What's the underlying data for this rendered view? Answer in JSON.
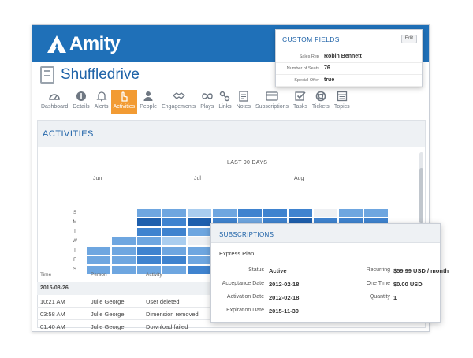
{
  "app": {
    "logo_text": "Amity"
  },
  "account": {
    "name": "Shuffledrive"
  },
  "tabs": [
    {
      "label": "Dashboard",
      "icon": "dashboard-icon",
      "active": false
    },
    {
      "label": "Details",
      "icon": "info-icon",
      "active": false
    },
    {
      "label": "Alerts",
      "icon": "bell-icon",
      "active": false
    },
    {
      "label": "Activities",
      "icon": "hand-pointer-icon",
      "active": true
    },
    {
      "label": "People",
      "icon": "person-icon",
      "active": false
    },
    {
      "label": "Engagements",
      "icon": "handshake-icon",
      "active": false
    },
    {
      "label": "Plays",
      "icon": "infinity-icon",
      "active": false
    },
    {
      "label": "Links",
      "icon": "link-icon",
      "active": false
    },
    {
      "label": "Notes",
      "icon": "note-icon",
      "active": false
    },
    {
      "label": "Subscriptions",
      "icon": "card-icon",
      "active": false
    },
    {
      "label": "Tasks",
      "icon": "checkbox-icon",
      "active": false
    },
    {
      "label": "Tickets",
      "icon": "lifebuoy-icon",
      "active": false
    },
    {
      "label": "Topics",
      "icon": "topics-icon",
      "active": false
    }
  ],
  "activities": {
    "title": "ACTIVITIES",
    "heatmap_title": "LAST 90 DAYS",
    "months": [
      "Jun",
      "Jul",
      "Aug"
    ],
    "days": [
      "S",
      "M",
      "T",
      "W",
      "T",
      "F",
      "S"
    ],
    "table_headers": {
      "time": "Time",
      "person": "Person",
      "activity": "Activity"
    },
    "date_group": "2015-08-26",
    "rows": [
      {
        "time": "10:21 AM",
        "person": "Julie George",
        "activity": "User deleted"
      },
      {
        "time": "03:58 AM",
        "person": "Julie George",
        "activity": "Dimension removed"
      },
      {
        "time": "01:40 AM",
        "person": "Julie George",
        "activity": "Download failed"
      }
    ]
  },
  "chart_data": {
    "type": "heatmap",
    "title": "LAST 90 DAYS",
    "x_labels": [
      "Jun",
      "Jul",
      "Aug"
    ],
    "y": [
      "S",
      "M",
      "T",
      "W",
      "T",
      "F",
      "S"
    ],
    "scale": "0 = no activity, 4 = highest",
    "columns": 12,
    "rows": [
      [
        null,
        null,
        2,
        2,
        1,
        2,
        3,
        3,
        3,
        0,
        2,
        2
      ],
      [
        null,
        null,
        4,
        3,
        4,
        3,
        2,
        3,
        4,
        3,
        3,
        3
      ],
      [
        null,
        null,
        3,
        3,
        2,
        3,
        3,
        4,
        3,
        2,
        3,
        3
      ],
      [
        null,
        2,
        2,
        1,
        0,
        3,
        3,
        3,
        4,
        3,
        1,
        2
      ],
      [
        2,
        2,
        3,
        2,
        2,
        2,
        2,
        3,
        4,
        3,
        3,
        2
      ],
      [
        2,
        2,
        3,
        3,
        2,
        2,
        2,
        null,
        null,
        null,
        null,
        null
      ],
      [
        2,
        2,
        2,
        2,
        3,
        2,
        2,
        null,
        null,
        null,
        null,
        null
      ]
    ]
  },
  "custom_fields": {
    "title": "CUSTOM FIELDS",
    "edit_label": "Edit",
    "fields": [
      {
        "label": "Sales Rep",
        "value": "Robin Bennett"
      },
      {
        "label": "Number of Seats",
        "value": "76"
      },
      {
        "label": "Special Offer",
        "value": "true"
      }
    ]
  },
  "subscriptions": {
    "title": "SUBSCRIPTIONS",
    "plan": "Express Plan",
    "left": [
      {
        "label": "Status",
        "value": "Active"
      },
      {
        "label": "Acceptance Date",
        "value": "2012-02-18"
      },
      {
        "label": "Activation Date",
        "value": "2012-02-18"
      },
      {
        "label": "Expiration Date",
        "value": "2015-11-30"
      }
    ],
    "right": [
      {
        "label": "Recurring",
        "value": "$59.99 USD / month"
      },
      {
        "label": "One Time",
        "value": "$0.00 USD"
      },
      {
        "label": "Quantity",
        "value": "1"
      }
    ]
  },
  "colors": {
    "brand": "#1f70b8",
    "active_tab": "#f29b33",
    "heat_levels": [
      "#eef0f3",
      "#a9cdef",
      "#6ea6e0",
      "#3f83cf",
      "#1e5fad"
    ]
  }
}
